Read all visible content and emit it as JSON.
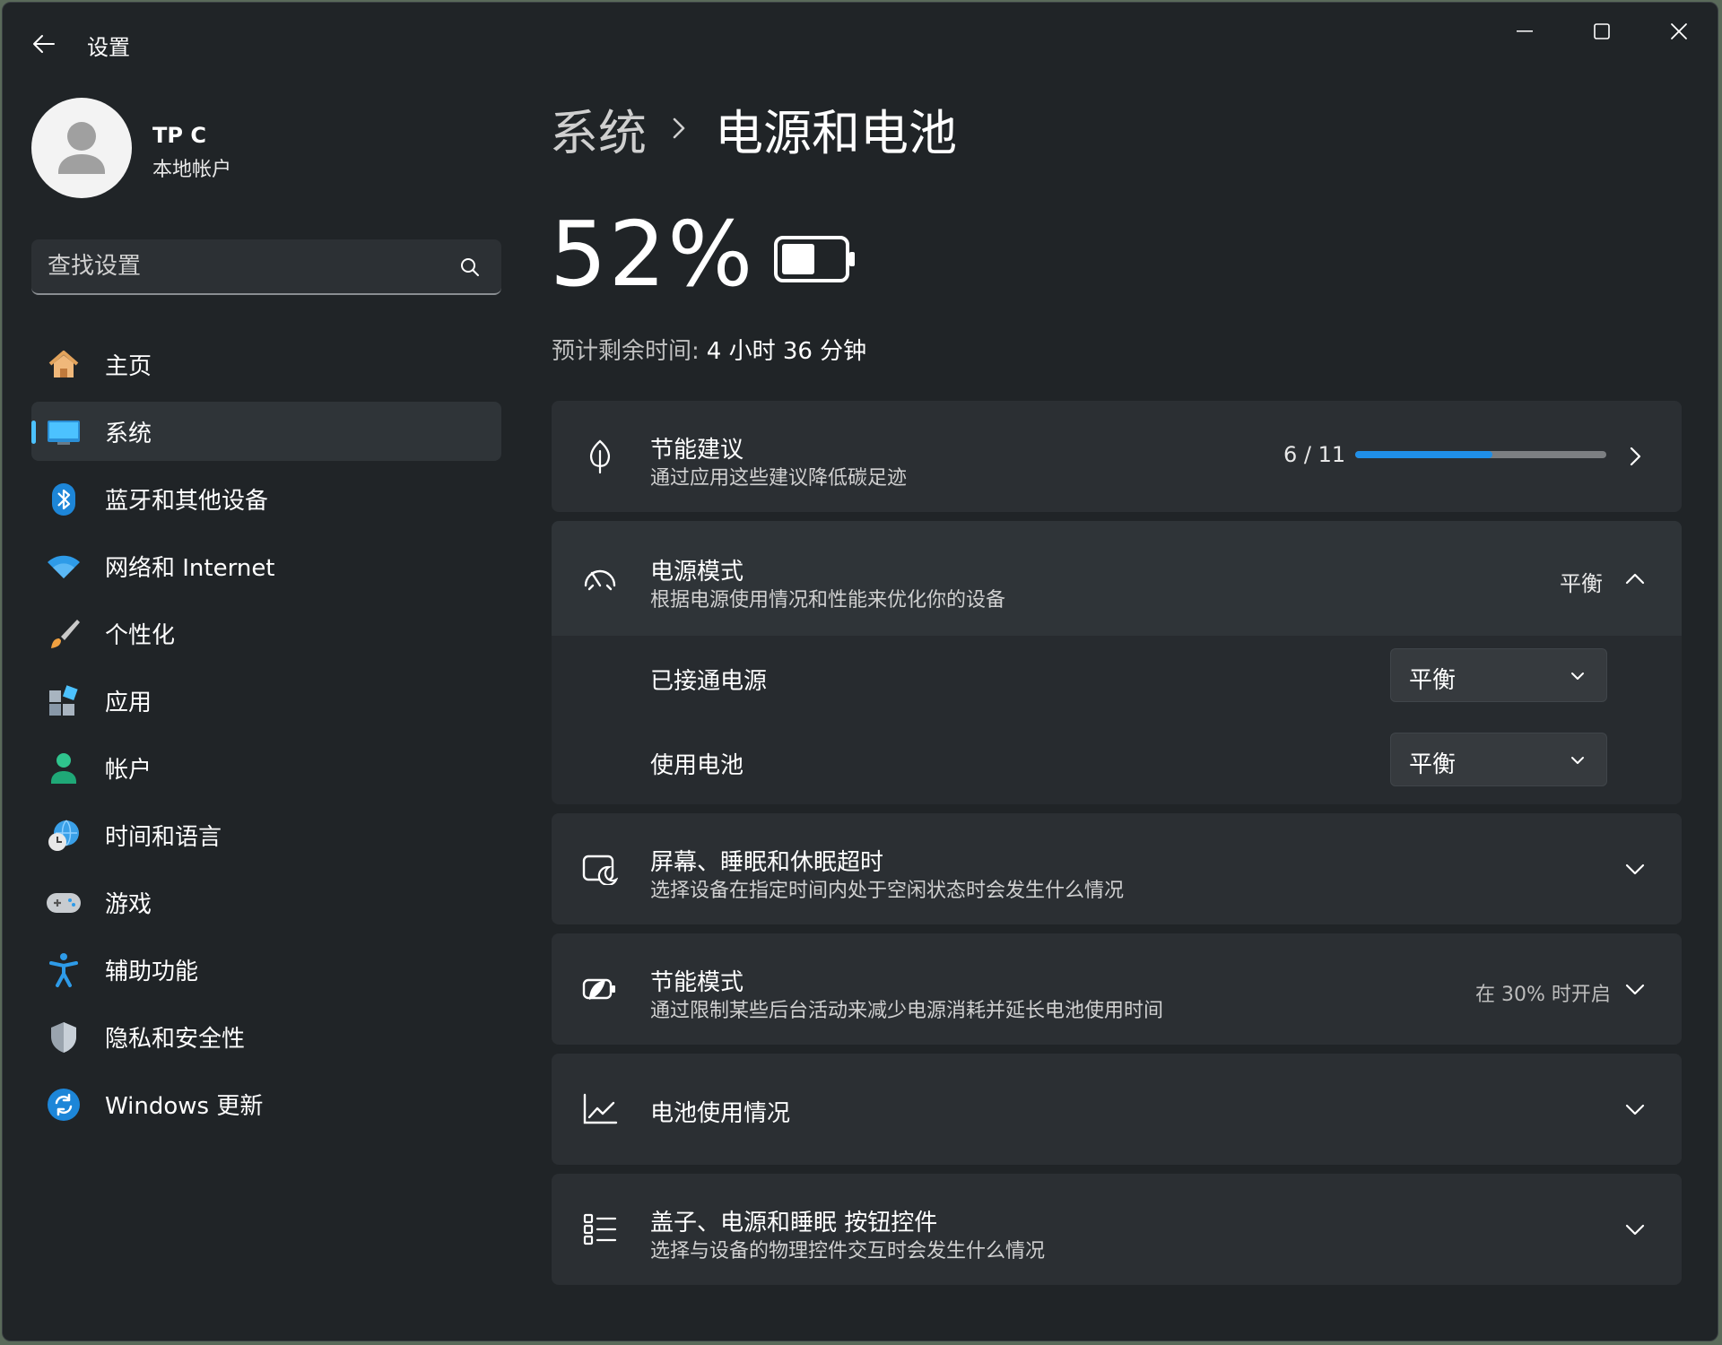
{
  "window": {
    "title": "设置"
  },
  "profile": {
    "name": "TP C",
    "account_type": "本地帐户"
  },
  "search": {
    "placeholder": "查找设置"
  },
  "sidebar": {
    "items": [
      {
        "label": "主页",
        "icon": "home-icon",
        "selected": false
      },
      {
        "label": "系统",
        "icon": "system-icon",
        "selected": true
      },
      {
        "label": "蓝牙和其他设备",
        "icon": "bluetooth-icon",
        "selected": false
      },
      {
        "label": "网络和 Internet",
        "icon": "wifi-icon",
        "selected": false
      },
      {
        "label": "个性化",
        "icon": "brush-icon",
        "selected": false
      },
      {
        "label": "应用",
        "icon": "apps-icon",
        "selected": false
      },
      {
        "label": "帐户",
        "icon": "account-icon",
        "selected": false
      },
      {
        "label": "时间和语言",
        "icon": "time-language-icon",
        "selected": false
      },
      {
        "label": "游戏",
        "icon": "gamepad-icon",
        "selected": false
      },
      {
        "label": "辅助功能",
        "icon": "accessibility-icon",
        "selected": false
      },
      {
        "label": "隐私和安全性",
        "icon": "shield-icon",
        "selected": false
      },
      {
        "label": "Windows 更新",
        "icon": "update-icon",
        "selected": false
      }
    ],
    "accent_color": "#4cc2ff"
  },
  "breadcrumb": {
    "parent": "系统",
    "current": "电源和电池"
  },
  "battery": {
    "percent_text": "52%",
    "level": 0.52,
    "remaining_label": "预计剩余时间:",
    "remaining_value": "4 小时 36 分钟"
  },
  "cards": {
    "energy_recommendations": {
      "title": "节能建议",
      "description": "通过应用这些建议降低碳足迹",
      "progress_text": "6 / 11",
      "progress_fraction": 0.545,
      "progress_color": "#1f8fe8"
    },
    "power_mode": {
      "title": "电源模式",
      "description": "根据电源使用情况和性能来优化你的设备",
      "value": "平衡",
      "expanded": true,
      "plugged_in_label": "已接通电源",
      "plugged_in_value": "平衡",
      "on_battery_label": "使用电池",
      "on_battery_value": "平衡"
    },
    "screen_sleep": {
      "title": "屏幕、睡眠和休眠超时",
      "description": "选择设备在指定时间内处于空闲状态时会发生什么情况"
    },
    "energy_saver": {
      "title": "节能模式",
      "description": "通过限制某些后台活动来减少电源消耗并延长电池使用时间",
      "value": "在 30% 时开启"
    },
    "battery_usage": {
      "title": "电池使用情况"
    },
    "lid_power_buttons": {
      "title": "盖子、电源和睡眠 按钮控件",
      "description": "选择与设备的物理控件交互时会发生什么情况"
    }
  }
}
